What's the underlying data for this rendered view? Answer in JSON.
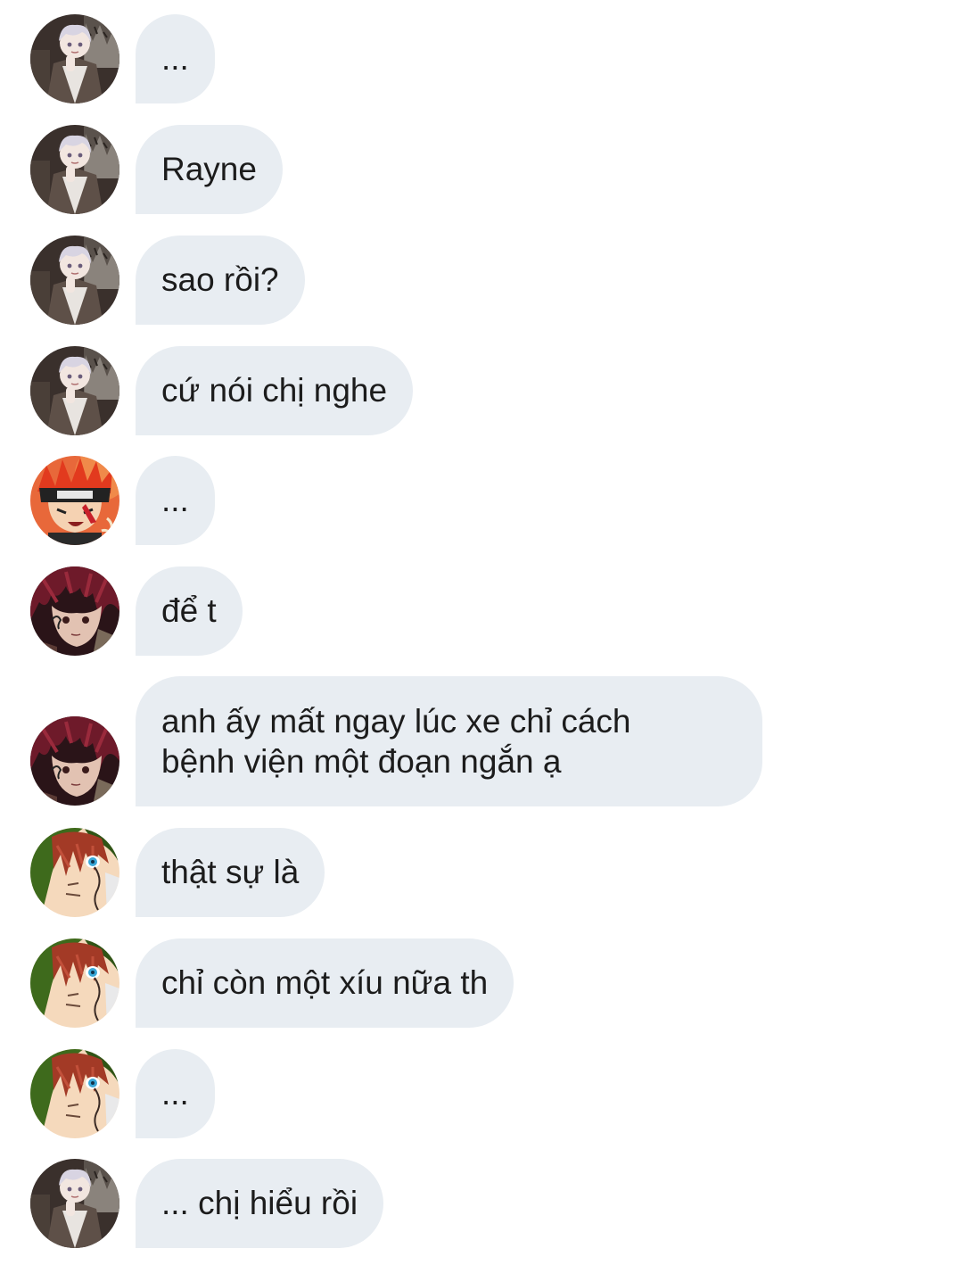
{
  "conversation": {
    "messages": [
      {
        "avatar": "silver-haired-character-avatar",
        "text": "..."
      },
      {
        "avatar": "silver-haired-character-avatar",
        "text": "Rayne"
      },
      {
        "avatar": "silver-haired-character-avatar",
        "text": "sao rồi?"
      },
      {
        "avatar": "silver-haired-character-avatar",
        "text": "cứ nói chị nghe"
      },
      {
        "avatar": "red-haired-headband-character-avatar",
        "text": "..."
      },
      {
        "avatar": "dark-red-haired-character-avatar",
        "text": "để t"
      },
      {
        "avatar": "dark-red-haired-character-avatar",
        "lines": [
          "anh ấy mất ngay lúc xe chỉ cách",
          "bệnh viện một đoạn ngắn ạ"
        ]
      },
      {
        "avatar": "green-hooded-character-avatar",
        "text": "thật sự là"
      },
      {
        "avatar": "green-hooded-character-avatar",
        "text": "chỉ còn một xíu nữa th"
      },
      {
        "avatar": "green-hooded-character-avatar",
        "text": "..."
      },
      {
        "avatar": "silver-haired-character-avatar",
        "text": "... chị hiểu rồi"
      }
    ]
  },
  "colors": {
    "bubble_background": "#e8edf2",
    "text": "#1c1c1c",
    "page_background": "#ffffff"
  }
}
